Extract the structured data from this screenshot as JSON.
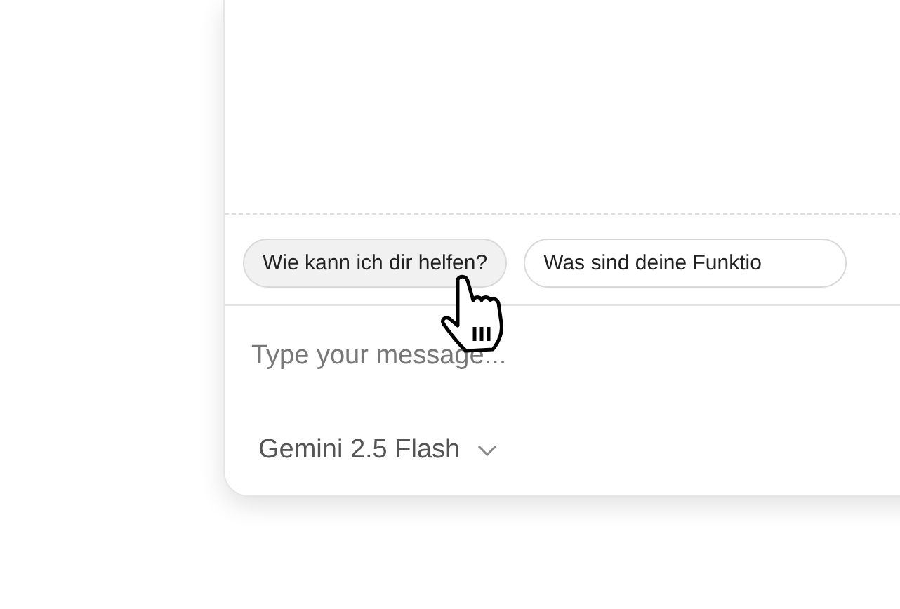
{
  "suggestions": [
    {
      "label": "Wie kann ich dir helfen?",
      "hovered": true
    },
    {
      "label": "Was sind deine Funktio",
      "hovered": false
    }
  ],
  "message_input": {
    "placeholder": "Type your message..."
  },
  "model_selector": {
    "label": "Gemini 2.5 Flash"
  }
}
